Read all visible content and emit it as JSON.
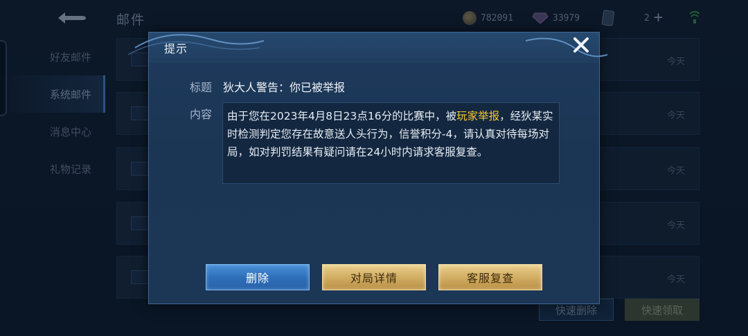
{
  "page": {
    "title": "邮件"
  },
  "sidebar": {
    "items": [
      {
        "label": "好友邮件",
        "active": false
      },
      {
        "label": "系统邮件",
        "active": true
      },
      {
        "label": "消息中心",
        "active": false
      },
      {
        "label": "礼物记录",
        "active": false
      }
    ]
  },
  "resources": {
    "coins": "782091",
    "gems": "33979",
    "cards": "2"
  },
  "mail_list": {
    "rows": [
      {
        "date": "今天"
      },
      {
        "date": "今天"
      },
      {
        "date": "今天"
      },
      {
        "date": "今天"
      },
      {
        "date": "今天"
      }
    ]
  },
  "bottom_actions": {
    "quick_delete": "快速删除",
    "quick_claim": "快速领取"
  },
  "dialog": {
    "title": "提示",
    "subject_label": "标题",
    "subject": "狄大人警告：你已被举报",
    "content_label": "内容",
    "content_before": "由于您在2023年4月8日23点16分的比赛中，被",
    "content_highlight": "玩家举报",
    "content_after": "，经狄某实时检测判定您存在故意送人头行为，信誉积分-4，请认真对待每场对局，如对判罚结果有疑问请在24小时内请求客服复查。",
    "buttons": {
      "delete": "删除",
      "match_details": "对局详情",
      "cs_review": "客服复查"
    }
  },
  "colors": {
    "highlight": "#f5c731",
    "primary_button": "#2d6db8",
    "gold_button": "#d2ae63"
  }
}
